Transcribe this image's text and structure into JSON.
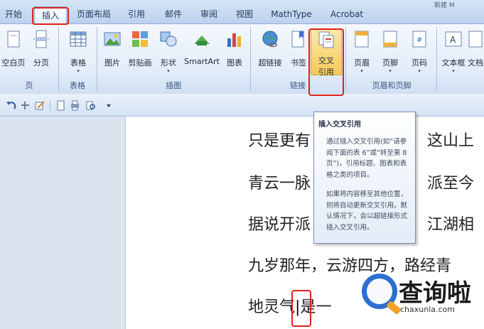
{
  "tabs": [
    {
      "label": "开始"
    },
    {
      "label": "插入"
    },
    {
      "label": "页面布局"
    },
    {
      "label": "引用"
    },
    {
      "label": "邮件"
    },
    {
      "label": "审阅"
    },
    {
      "label": "视图"
    },
    {
      "label": "MathType"
    },
    {
      "label": "Acrobat"
    }
  ],
  "window_title_fragment": "新建 M",
  "ribbon": {
    "buttons": [
      {
        "label": "空白页"
      },
      {
        "label": "分页"
      },
      {
        "label": "表格",
        "dropdown": "▾"
      },
      {
        "label": "图片"
      },
      {
        "label": "剪贴画"
      },
      {
        "label": "形状",
        "dropdown": "▾"
      },
      {
        "label": "SmartArt"
      },
      {
        "label": "图表"
      },
      {
        "label": "超链接"
      },
      {
        "label": "书签"
      },
      {
        "label": "交叉",
        "label2": "引用"
      },
      {
        "label": "页眉",
        "dropdown": "▾"
      },
      {
        "label": "页脚",
        "dropdown": "▾"
      },
      {
        "label": "页码",
        "dropdown": "▾"
      },
      {
        "label": "文本框",
        "dropdown": "▾"
      },
      {
        "label": "文档"
      }
    ],
    "groups": [
      {
        "label": "页"
      },
      {
        "label": "表格"
      },
      {
        "label": "插图"
      },
      {
        "label": "链接"
      },
      {
        "label": "页眉和页脚"
      }
    ]
  },
  "tooltip": {
    "title": "插入交叉引用",
    "p1": "通过插入交叉引用(如“请参\n阅下面的表 6”或“转至第 8\n页”)，引用标题、图表和表\n格之类的项目。",
    "p2": "如果将内容移至其他位置，\n则将自动更新交叉引用。默\n认情况下，会以超链接形式\n插入交叉引用。"
  },
  "document": {
    "lines": [
      {
        "left": "只是更有",
        "right": "这山上"
      },
      {
        "left": "青云一脉",
        "right": "派至今"
      },
      {
        "left": "据说开派",
        "right": "江湖相"
      },
      {
        "left": "九岁那年，云游四方，路经青",
        "right": ""
      },
      {
        "left": "地灵气",
        "cursor": "|",
        "right": "是一"
      }
    ]
  },
  "watermark": {
    "brand": "查询啦",
    "url": "chaxunla.com"
  },
  "colors": {
    "annotation": "#e0201a",
    "highlight": "#f7c95a",
    "ribbon": "#dbe7f6"
  }
}
